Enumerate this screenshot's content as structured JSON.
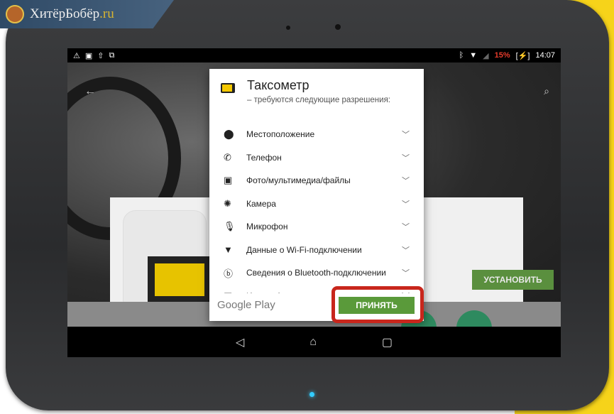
{
  "watermark": {
    "name": "ХитёрБобёр",
    "tld": ".ru"
  },
  "status_bar": {
    "icons_left": [
      "warning-icon",
      "image-icon",
      "upload-icon",
      "sync-icon"
    ],
    "icons_right": [
      "bluetooth-icon",
      "wifi-icon",
      "signal-icon"
    ],
    "battery": "15%",
    "time": "14:07"
  },
  "background_app": {
    "install_label": "УСТАНОВИТЬ"
  },
  "dialog": {
    "title": "Таксометр",
    "subtitle": "– требуются следующие разрешения:",
    "permissions": [
      {
        "icon": "location-icon",
        "glyph": "⬤",
        "label": "Местоположение"
      },
      {
        "icon": "phone-icon",
        "glyph": "✆",
        "label": "Телефон"
      },
      {
        "icon": "photos-icon",
        "glyph": "▣",
        "label": "Фото/мультимедиа/файлы"
      },
      {
        "icon": "camera-icon",
        "glyph": "✺",
        "label": "Камера"
      },
      {
        "icon": "microphone-icon",
        "glyph": "🎙",
        "label": "Микрофон"
      },
      {
        "icon": "wifi-icon",
        "glyph": "▼",
        "label": "Данные о Wi-Fi-подключении"
      },
      {
        "icon": "bluetooth-icon",
        "glyph": "ⓑ",
        "label": "Сведения о Bluetooth-подключении"
      },
      {
        "icon": "device-id-icon",
        "glyph": "▤",
        "label": "Идентификатор устр"
      }
    ],
    "footer_brand": "Google Play",
    "accept_label": "ПРИНЯТЬ"
  },
  "nav": {
    "back": "◁",
    "home": "⌂",
    "recents": "▢"
  },
  "colors": {
    "accent_green": "#5a9a3a",
    "highlight_red": "#c8261c",
    "battery_red": "#e53b2b"
  }
}
